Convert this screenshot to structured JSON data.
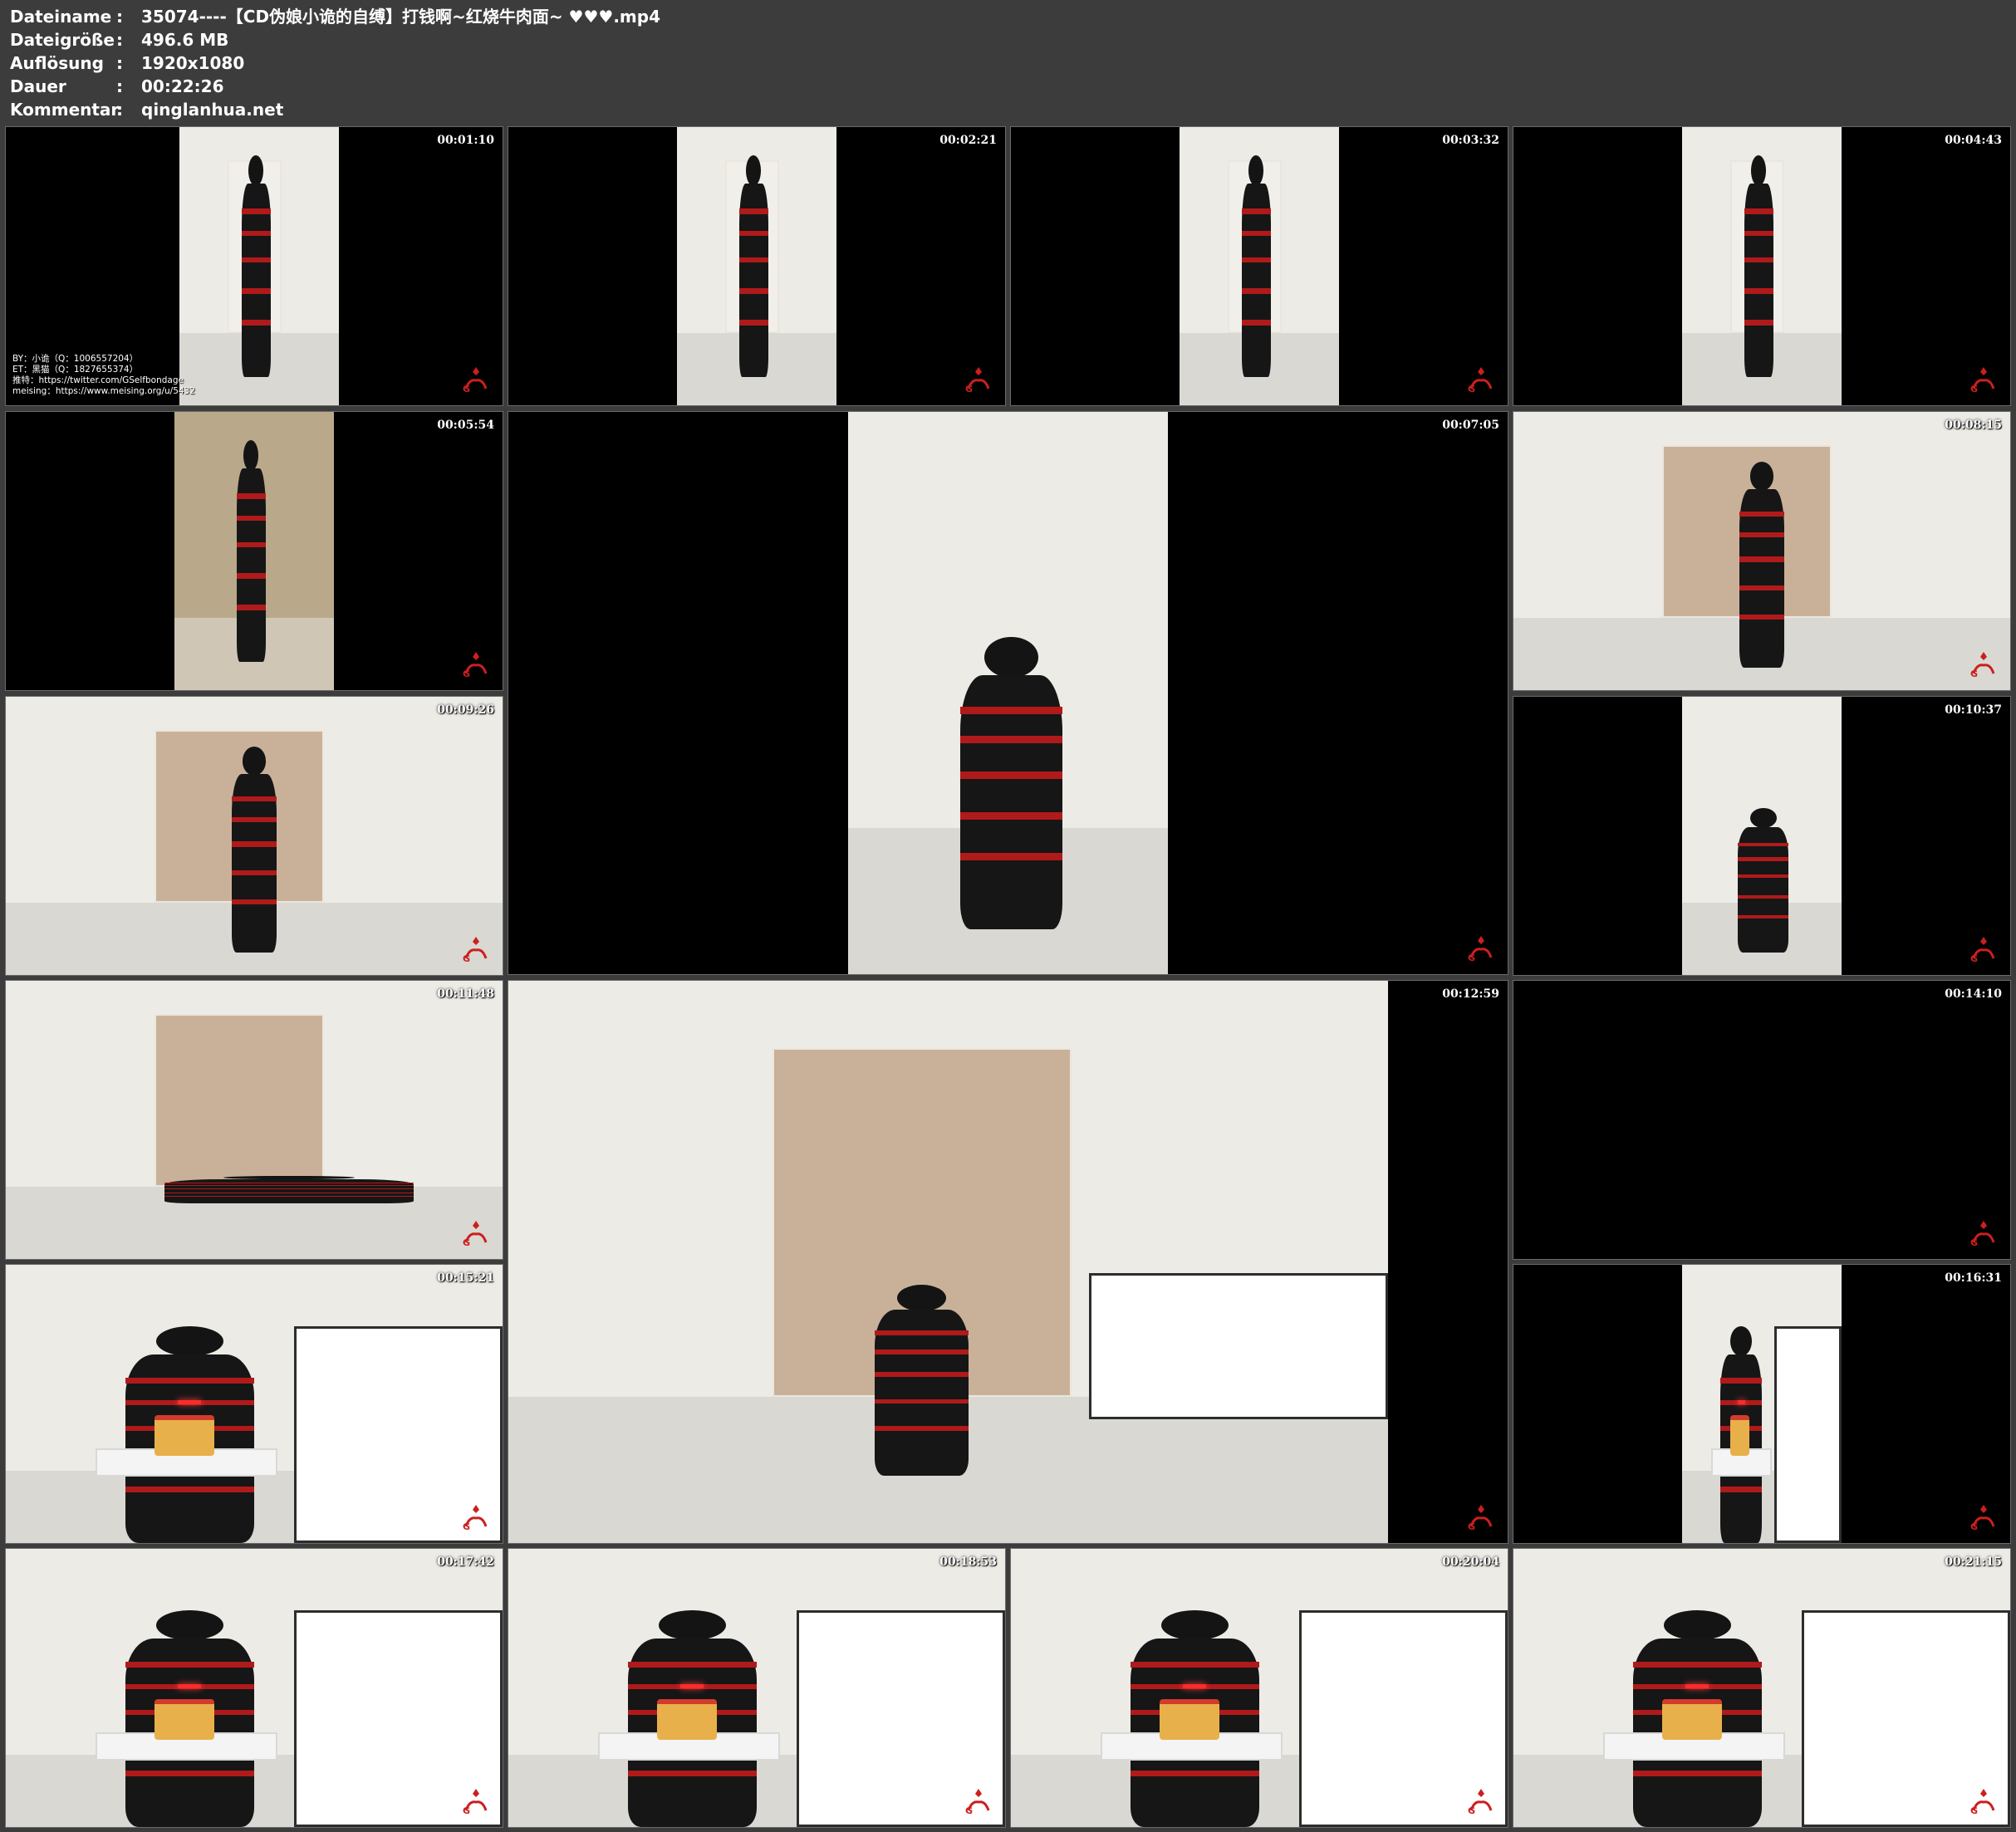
{
  "info": {
    "rows": [
      {
        "label": "Dateiname",
        "sep": ":",
        "value": "35074----【CD伪娘小诡的自缚】打钱啊~红烧牛肉面~ ♥♥♥.mp4"
      },
      {
        "label": "Dateigröße",
        "sep": ":",
        "value": "496.6 MB"
      },
      {
        "label": "Auflösung",
        "sep": ":",
        "value": "1920x1080"
      },
      {
        "label": "Dauer",
        "sep": ":",
        "value": "00:22:26"
      },
      {
        "label": "Kommentar",
        "sep": ":",
        "value": "qinglanhua.net"
      }
    ]
  },
  "credit": {
    "lines": [
      "BY：小诡（Q：1006557204）",
      "ET：黑猫（Q：1827655374）",
      "推特：https://twitter.com/GSelfbondage",
      "meising：https://www.meising.org/u/5432"
    ]
  },
  "thumbnails": [
    {
      "time": "00:01:10",
      "icon": "video-frame"
    },
    {
      "time": "00:02:21",
      "icon": "video-frame"
    },
    {
      "time": "00:03:32",
      "icon": "video-frame"
    },
    {
      "time": "00:04:43",
      "icon": "video-frame"
    },
    {
      "time": "00:05:54",
      "icon": "video-frame"
    },
    {
      "time": "00:07:05",
      "icon": "video-frame"
    },
    {
      "time": "00:08:15",
      "icon": "video-frame"
    },
    {
      "time": "00:09:26",
      "icon": "video-frame"
    },
    {
      "time": "00:10:37",
      "icon": "video-frame"
    },
    {
      "time": "00:11:48",
      "icon": "video-frame"
    },
    {
      "time": "00:12:59",
      "icon": "video-frame"
    },
    {
      "time": "00:14:10",
      "icon": "video-frame"
    },
    {
      "time": "00:15:21",
      "icon": "video-frame"
    },
    {
      "time": "00:16:31",
      "icon": "video-frame"
    },
    {
      "time": "00:17:42",
      "icon": "video-frame"
    },
    {
      "time": "00:18:53",
      "icon": "video-frame"
    },
    {
      "time": "00:20:04",
      "icon": "video-frame"
    },
    {
      "time": "00:21:15",
      "icon": "video-frame"
    }
  ],
  "colors": {
    "background": "#3c3c3c",
    "rope": "#b01a1a",
    "logo": "#cc1f1f"
  }
}
